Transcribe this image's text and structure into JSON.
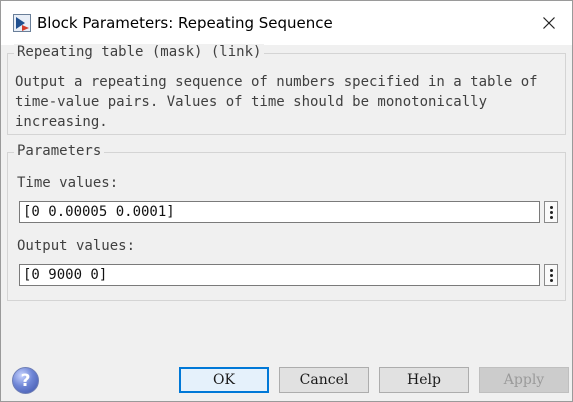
{
  "window": {
    "title": "Block Parameters: Repeating Sequence"
  },
  "mask_group": {
    "legend": "Repeating table (mask) (link)",
    "description": "Output a repeating sequence of numbers specified in a table of time-value pairs. Values of time should be monotonically increasing."
  },
  "params_group": {
    "legend": "Parameters",
    "time": {
      "label": "Time values:",
      "value": "[0 0.00005 0.0001]"
    },
    "output": {
      "label": "Output values:",
      "value": "[0 9000 0]"
    }
  },
  "buttons": {
    "ok": "OK",
    "cancel": "Cancel",
    "help": "Help",
    "apply": "Apply",
    "help_icon": "?"
  },
  "icons": {
    "app": "simulink-block-icon",
    "close": "close-icon",
    "help": "help-question-icon",
    "more": "kebab-menu-icon"
  },
  "colors": {
    "default_button_border": "#0078d7",
    "disabled_text": "#9a9a9a"
  }
}
